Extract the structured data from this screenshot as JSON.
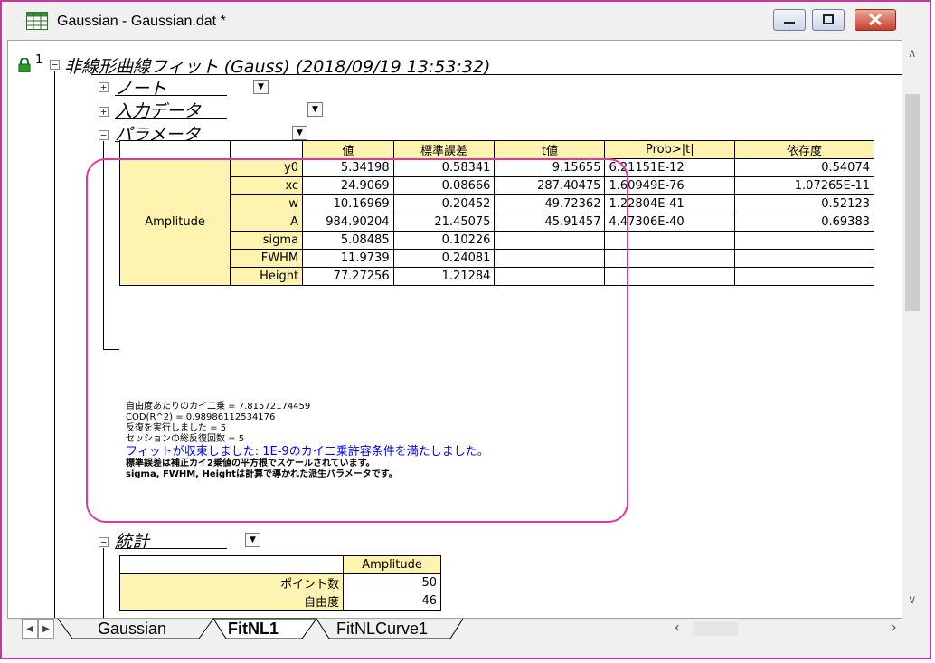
{
  "window": {
    "title": "Gaussian - Gaussian.dat *",
    "controls": [
      "minimize",
      "maximize",
      "close"
    ]
  },
  "report": {
    "row_number": "1",
    "main_heading": "非線形曲線フィット (Gauss) (2018/09/19 13:53:32)",
    "sections": {
      "notes": "ノート",
      "input_data": "入力データ",
      "parameters": "パラメータ",
      "statistics": "統計"
    },
    "param_table": {
      "headers": [
        "値",
        "標準誤差",
        "t値",
        "Prob>|t|",
        "依存度"
      ],
      "group_label": "Amplitude",
      "rows": [
        {
          "name": "y0",
          "values": [
            "5.34198",
            "0.58341",
            "9.15655",
            "6.21151E-12",
            "0.54074"
          ]
        },
        {
          "name": "xc",
          "values": [
            "24.9069",
            "0.08666",
            "287.40475",
            "1.60949E-76",
            "1.07265E-11"
          ]
        },
        {
          "name": "w",
          "values": [
            "10.16969",
            "0.20452",
            "49.72362",
            "1.22804E-41",
            "0.52123"
          ]
        },
        {
          "name": "A",
          "values": [
            "984.90204",
            "21.45075",
            "45.91457",
            "4.47306E-40",
            "0.69383"
          ]
        },
        {
          "name": "sigma",
          "values": [
            "5.08485",
            "0.10226",
            "",
            "",
            ""
          ]
        },
        {
          "name": "FWHM",
          "values": [
            "11.9739",
            "0.24081",
            "",
            "",
            ""
          ]
        },
        {
          "name": "Height",
          "values": [
            "77.27256",
            "1.21284",
            "",
            "",
            ""
          ]
        }
      ]
    },
    "notes_lines": {
      "chi_sq": "自由度あたりのカイ二乗 = 7.81572174459",
      "cod": "COD(R^2) = 0.98986112534176",
      "iterations": "反復を実行しました = 5",
      "session_iterations": "セッションの総反復回数 = 5",
      "converged": "フィットが収束しました: 1E-9のカイ二乗許容条件を満たしました。",
      "std_err_note": "標準誤差は補正カイ2乗値の平方根でスケールされています。",
      "derived_note": "sigma, FWHM, Heightは計算で導かれた派生パラメータです。"
    },
    "stats_table": {
      "header": "Amplitude",
      "rows": [
        {
          "name": "ポイント数",
          "value": "50"
        },
        {
          "name": "自由度",
          "value": "46"
        }
      ]
    }
  },
  "tabs": [
    "Gaussian",
    "FitNL1",
    "FitNLCurve1"
  ],
  "active_tab": "FitNL1"
}
